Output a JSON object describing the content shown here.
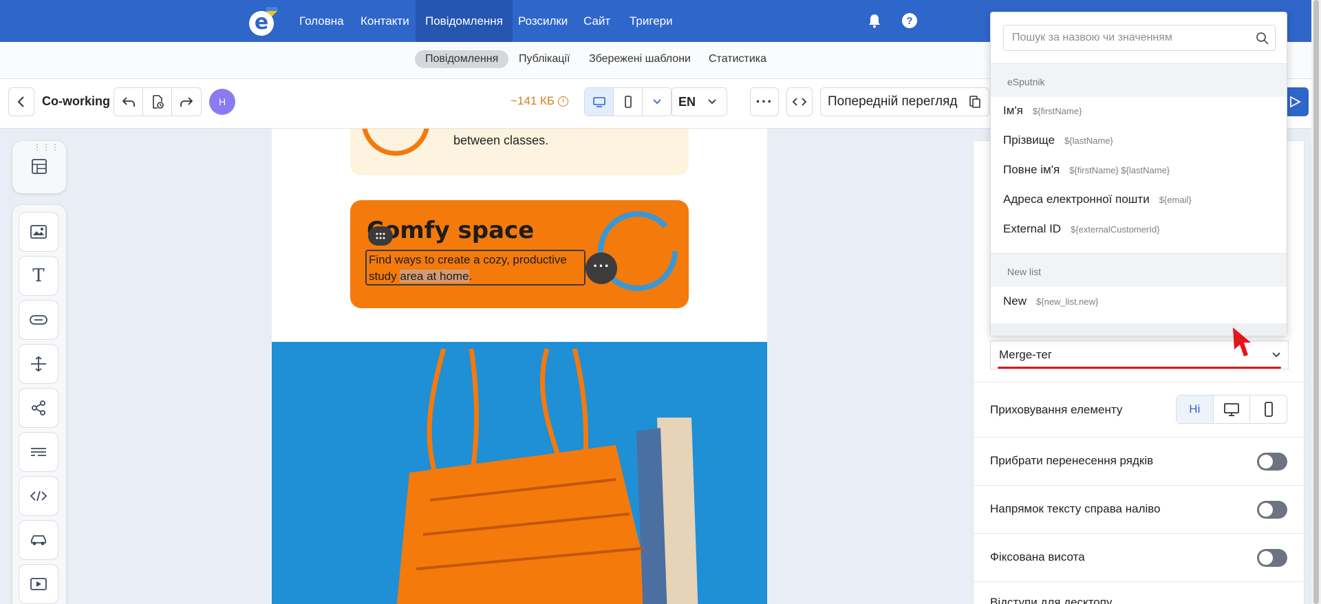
{
  "topnav": {
    "items": [
      "Головна",
      "Контакти",
      "Повідомлення",
      "Розсилки",
      "Сайт",
      "Тригери"
    ],
    "active_index": 2,
    "brand_color": "#2f66c9"
  },
  "subnav": {
    "items": [
      "Повідомлення",
      "Публікації",
      "Збережені шаблони",
      "Статистика"
    ],
    "active_index": 0
  },
  "toolbar": {
    "title": "Co-working",
    "avatar_initial": "Н",
    "size": "~141 КБ",
    "language": "EN",
    "preview_label": "Попередній перегляд"
  },
  "canvas": {
    "card1_text_line1": "between classes.",
    "card2_title": "Comfy space",
    "card2_text_plain": "Find ways to create a cozy, productive study ",
    "card2_text_highlight": "area at home",
    "card2_text_end": ".",
    "accent_color": "#f47a0c"
  },
  "dropdown": {
    "search_placeholder": "Пошук за назвою чи значенням",
    "groups": [
      {
        "name": "eSputnik",
        "items": [
          {
            "label": "Ім'я",
            "code": "${firstName}"
          },
          {
            "label": "Прізвище",
            "code": "${lastName}"
          },
          {
            "label": "Повне ім'я",
            "code": "${firstName} ${lastName}"
          },
          {
            "label": "Адреса електронної пошти",
            "code": "${email}"
          },
          {
            "label": "External ID",
            "code": "${externalCustomerId}"
          }
        ]
      },
      {
        "name": "New list",
        "items": [
          {
            "label": "New",
            "code": "${new_list.new}"
          }
        ]
      }
    ]
  },
  "settings": {
    "merge_select": "Merge-тег",
    "hide_label": "Приховування елементу",
    "hide_options": [
      "Ні"
    ],
    "hide_active": "Ні",
    "line_break_label": "Прибрати перенесення рядків",
    "rtl_label": "Напрямок тексту справа наліво",
    "fixed_height_label": "Фіксована висота",
    "desktop_padding_label": "Відступи для десктопу",
    "highlight_color": "#e8141a"
  }
}
